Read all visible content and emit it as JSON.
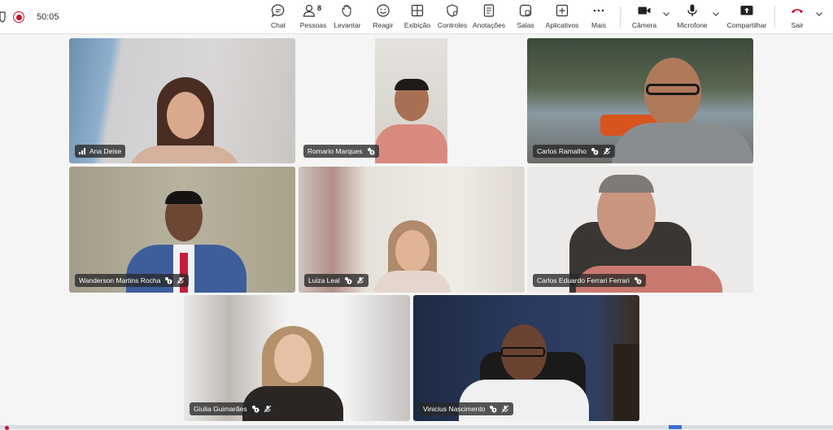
{
  "meeting": {
    "timer": "50:05"
  },
  "toolbar": {
    "people_count": "8",
    "buttons": [
      {
        "label": "Chat",
        "icon": "chat-icon"
      },
      {
        "label": "Pessoas",
        "icon": "people-icon"
      },
      {
        "label": "Levantar",
        "icon": "raise-hand-icon"
      },
      {
        "label": "Reagir",
        "icon": "react-icon"
      },
      {
        "label": "Exibição",
        "icon": "view-icon"
      },
      {
        "label": "Controles",
        "icon": "controls-icon"
      },
      {
        "label": "Anotações",
        "icon": "notes-icon"
      },
      {
        "label": "Salas",
        "icon": "rooms-icon"
      },
      {
        "label": "Aplicativos",
        "icon": "apps-icon"
      },
      {
        "label": "Mais",
        "icon": "more-icon"
      },
      {
        "label": "Câmera",
        "icon": "camera-icon"
      },
      {
        "label": "Microfone",
        "icon": "mic-icon"
      },
      {
        "label": "Compartilhar",
        "icon": "share-icon"
      },
      {
        "label": "Sair",
        "icon": "leave-icon"
      }
    ]
  },
  "participants": [
    {
      "name": "Ana Deise"
    },
    {
      "name": "Romario Marques"
    },
    {
      "name": "Carlos Ramalho"
    },
    {
      "name": "Wanderson Martins Rocha"
    },
    {
      "name": "Luiza Leal"
    },
    {
      "name": "Carlos Eduardo Ferrari Ferrari"
    },
    {
      "name": "Giulia Guimarães"
    },
    {
      "name": "Vinicius Nascimento"
    }
  ],
  "colors": {
    "record": "#c8102e",
    "leave": "#c8102e",
    "nameplate": "#282828"
  }
}
